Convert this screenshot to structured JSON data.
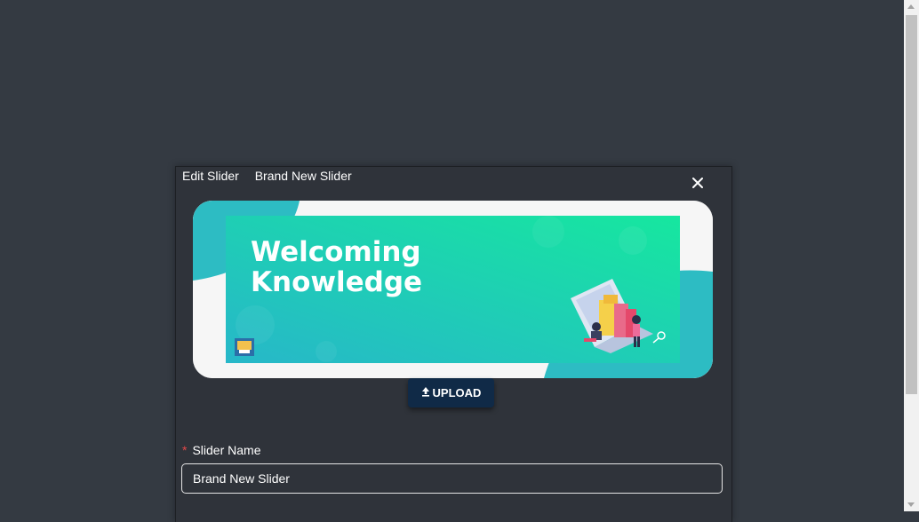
{
  "modal": {
    "title": "Edit Slider",
    "slider_title": "Brand New Slider",
    "close_icon": "close-icon"
  },
  "preview": {
    "headline_line1": "Welcoming",
    "headline_line2": "Knowledge",
    "colors": {
      "gradient_start": "#27b7c9",
      "gradient_end": "#16e79f",
      "wave": "#2dbcc3"
    }
  },
  "upload": {
    "label": "UPLOAD",
    "icon": "upload-icon"
  },
  "form": {
    "slider_name_label": "Slider Name",
    "required_mark": "*",
    "slider_name_value": "Brand New Slider"
  }
}
